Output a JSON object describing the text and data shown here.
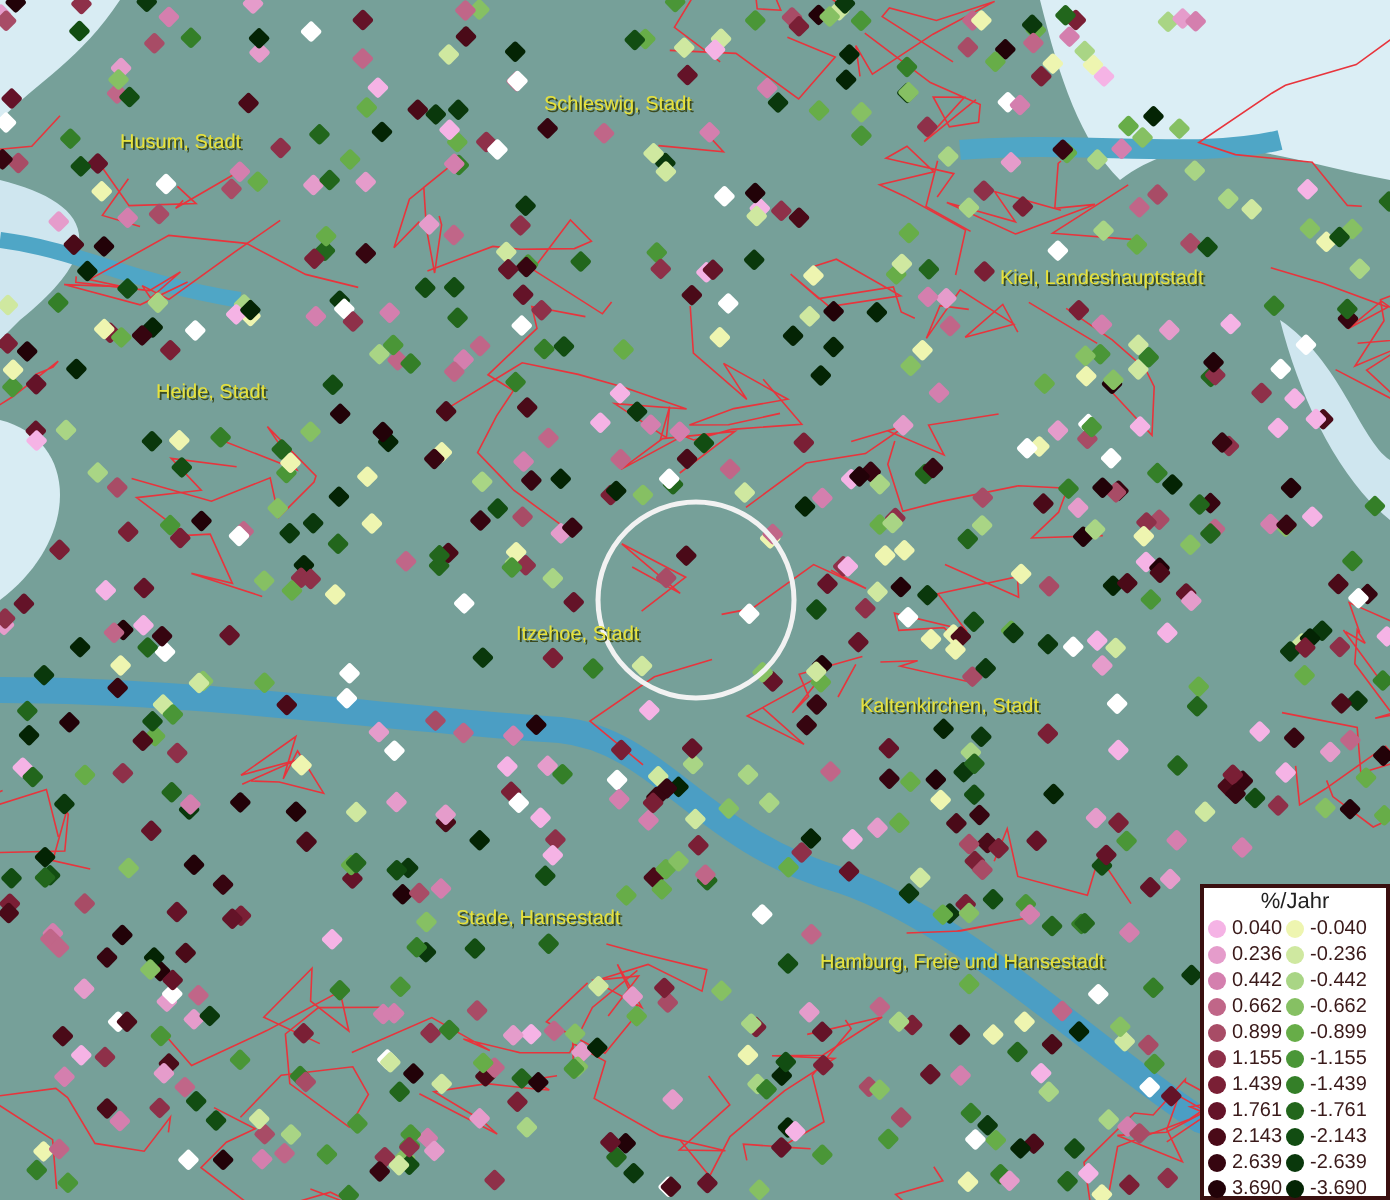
{
  "map": {
    "places": [
      {
        "name": "Schleswig, Stadt"
      },
      {
        "name": "Husum, Stadt"
      },
      {
        "name": "Kiel, Landeshauptstadt"
      },
      {
        "name": "Heide, Stadt"
      },
      {
        "name": "Itzehoe, Stadt"
      },
      {
        "name": "Kaltenkirchen, Stadt"
      },
      {
        "name": "Stade, Hansestadt"
      },
      {
        "name": "Hamburg, Freie und Hansestadt"
      }
    ]
  },
  "legend": {
    "title": "%/Jahr",
    "positive": [
      {
        "label": "0.040",
        "color": "#f5b3e5"
      },
      {
        "label": "0.236",
        "color": "#e59ccb"
      },
      {
        "label": "0.442",
        "color": "#d47fae"
      },
      {
        "label": "0.662",
        "color": "#c06688"
      },
      {
        "label": "0.899",
        "color": "#a84c66"
      },
      {
        "label": "1.155",
        "color": "#8e3049"
      },
      {
        "label": "1.439",
        "color": "#7a1f35"
      },
      {
        "label": "1.761",
        "color": "#641328"
      },
      {
        "label": "2.143",
        "color": "#4a0a18"
      },
      {
        "label": "2.639",
        "color": "#360510"
      },
      {
        "label": "3.690",
        "color": "#220208"
      }
    ],
    "negative": [
      {
        "label": "-0.040",
        "color": "#eef5b0"
      },
      {
        "label": "-0.236",
        "color": "#cfe8a0"
      },
      {
        "label": "-0.442",
        "color": "#a9d585"
      },
      {
        "label": "-0.662",
        "color": "#86c063"
      },
      {
        "label": "-0.899",
        "color": "#67ad48"
      },
      {
        "label": "-1.155",
        "color": "#4a9637"
      },
      {
        "label": "-1.439",
        "color": "#347f28"
      },
      {
        "label": "-1.761",
        "color": "#22661c"
      },
      {
        "label": "-2.143",
        "color": "#124d12"
      },
      {
        "label": "-2.639",
        "color": "#0a380c"
      },
      {
        "label": "-3.690",
        "color": "#042404"
      }
    ]
  }
}
